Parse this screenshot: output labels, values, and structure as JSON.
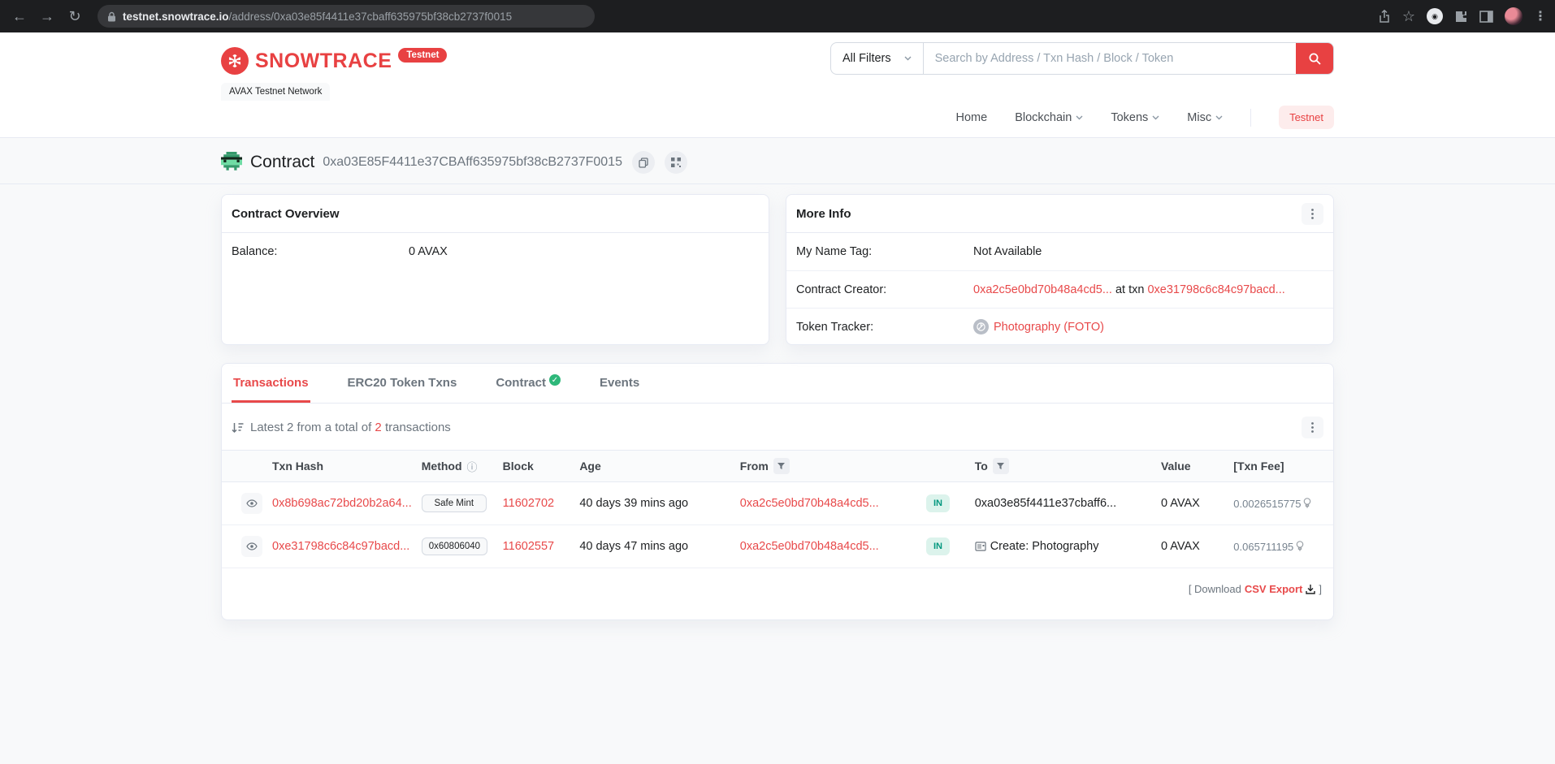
{
  "browser": {
    "url_host": "testnet.snowtrace.io",
    "url_path": "/address/0xa03e85f4411e37cbaff635975bf38cb2737f0015"
  },
  "header": {
    "brand": "SNOWTRACE",
    "brand_badge": "Testnet",
    "network_label": "AVAX Testnet Network",
    "search": {
      "filter_label": "All Filters",
      "placeholder": "Search by Address / Txn Hash / Block / Token"
    },
    "nav": [
      {
        "label": "Home"
      },
      {
        "label": "Blockchain"
      },
      {
        "label": "Tokens"
      },
      {
        "label": "Misc"
      }
    ],
    "testnet_pill": "Testnet"
  },
  "page": {
    "title": "Contract",
    "address": "0xa03E85F4411e37CBAff635975bf38cB2737F0015"
  },
  "overview_card": {
    "title": "Contract Overview",
    "balance_label": "Balance:",
    "balance_value": "0 AVAX"
  },
  "more_info_card": {
    "title": "More Info",
    "name_tag_label": "My Name Tag:",
    "name_tag_value": "Not Available",
    "creator_label": "Contract Creator:",
    "creator_address": "0xa2c5e0bd70b48a4cd5...",
    "creator_sep": "at txn",
    "creator_txn": "0xe31798c6c84c97bacd...",
    "tracker_label": "Token Tracker:",
    "tracker_value": "Photography (FOTO)"
  },
  "tabs": [
    {
      "label": "Transactions"
    },
    {
      "label": "ERC20 Token Txns"
    },
    {
      "label": "Contract"
    },
    {
      "label": "Events"
    }
  ],
  "txn_panel": {
    "summary_prefix": "Latest 2 from a total of",
    "summary_count": "2",
    "summary_suffix": "transactions",
    "columns": [
      "Txn Hash",
      "Method",
      "Block",
      "Age",
      "From",
      "To",
      "Value",
      "[Txn Fee]"
    ],
    "rows": [
      {
        "hash": "0x8b698ac72bd20b2a64...",
        "method": "Safe Mint",
        "block": "11602702",
        "age": "40 days 39 mins ago",
        "from": "0xa2c5e0bd70b48a4cd5...",
        "dir": "IN",
        "to": "0xa03e85f4411e37cbaff6...",
        "value": "0 AVAX",
        "fee": "0.0026515775"
      },
      {
        "hash": "0xe31798c6c84c97bacd...",
        "method": "0x60806040",
        "block": "11602557",
        "age": "40 days 47 mins ago",
        "from": "0xa2c5e0bd70b48a4cd5...",
        "dir": "IN",
        "to": "Create: Photography",
        "value": "0 AVAX",
        "fee": "0.065711195"
      }
    ],
    "download_prefix": "[ Download",
    "download_link": "CSV Export",
    "download_suffix": "]"
  },
  "colors": {
    "brand_red": "#e84142",
    "link_red": "#e8494a",
    "in_badge_bg": "#dcf3ec",
    "in_badge_text": "#02977e",
    "border": "#e7eaf3",
    "page_bg": "#f8f9fa"
  }
}
